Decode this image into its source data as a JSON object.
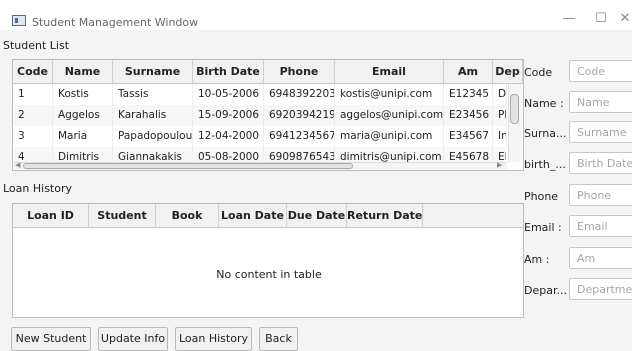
{
  "window": {
    "title": "Student Management Window",
    "controls": {
      "minimize": "—",
      "maximize": "☐",
      "close": "✕"
    }
  },
  "student_list": {
    "label": "Student List",
    "columns": [
      "Code",
      "Name",
      "Surname",
      "Birth Date",
      "Phone",
      "Email",
      "Am",
      "Dep"
    ],
    "rows": [
      [
        "1",
        "Kostis",
        "Tassis",
        "10-05-2006",
        "6948392203",
        "kostis@unipi.com",
        "E12345",
        "Di"
      ],
      [
        "2",
        "Aggelos",
        "Karahalis",
        "15-09-2006",
        "6920394219",
        "aggelos@unipi.com",
        "E23456",
        "Ph"
      ],
      [
        "3",
        "Maria",
        "Papadopoulou",
        "12-04-2000",
        "6941234567",
        "maria@unipi.com",
        "E34567",
        "In"
      ],
      [
        "4",
        "Dimitris",
        "Giannakakis",
        "05-08-2000",
        "6909876543",
        "dimitris@unipi.com",
        "E45678",
        "El"
      ]
    ]
  },
  "loan_history": {
    "label": "Loan History",
    "columns": [
      "Loan ID",
      "Student",
      "Book",
      "Loan Date",
      "Due Date",
      "Return Date"
    ],
    "empty_text": "No content in table"
  },
  "buttons": {
    "new_student": "New Student",
    "update_info": "Update Info",
    "loan_history": "Loan History",
    "back": "Back"
  },
  "form": {
    "code": {
      "label": "Code",
      "placeholder": "Code"
    },
    "name": {
      "label": "Name :",
      "placeholder": "Name"
    },
    "surname": {
      "label": "Surna...",
      "placeholder": "Surname"
    },
    "birth_date": {
      "label": "birth_...",
      "placeholder": "Birth Date"
    },
    "phone": {
      "label": "Phone",
      "placeholder": "Phone"
    },
    "email": {
      "label": "Email :",
      "placeholder": "Email"
    },
    "am": {
      "label": "Am :",
      "placeholder": "Am"
    },
    "department": {
      "label": "Depar...",
      "placeholder": "Departmer"
    }
  }
}
